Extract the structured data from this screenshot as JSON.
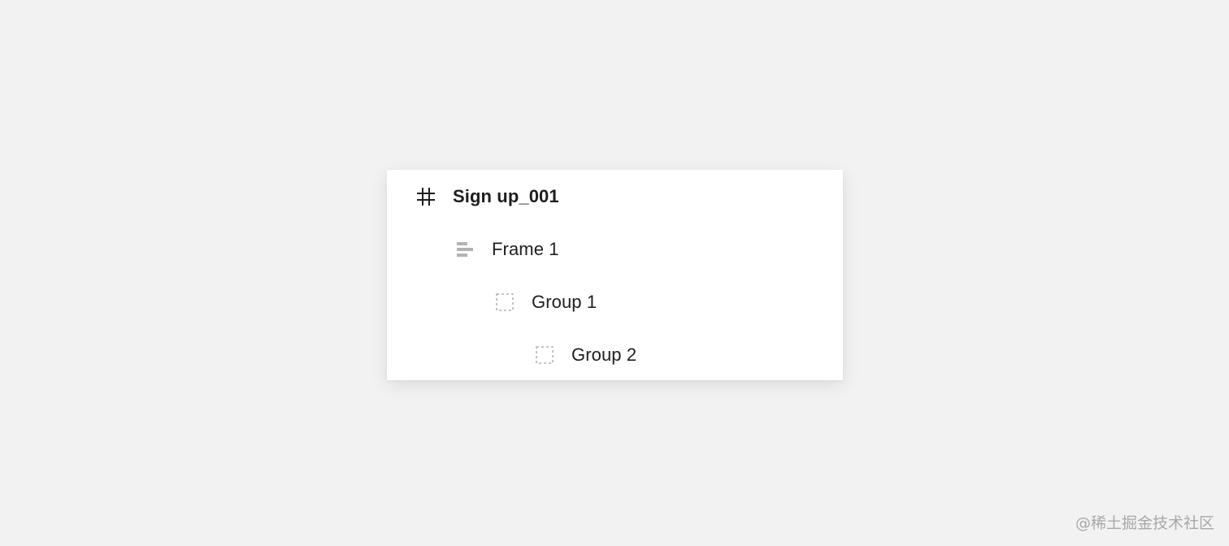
{
  "layers": [
    {
      "label": "Sign up_001",
      "icon": "frame-hash-icon"
    },
    {
      "label": "Frame 1",
      "icon": "auto-layout-icon"
    },
    {
      "label": "Group 1",
      "icon": "group-dashed-icon"
    },
    {
      "label": "Group 2",
      "icon": "group-dashed-icon"
    }
  ],
  "watermark": "@稀土掘金技术社区",
  "colors": {
    "background": "#f2f2f2",
    "panel": "#ffffff",
    "text": "#1e1e1e",
    "icon_muted": "#b3b3b3"
  }
}
